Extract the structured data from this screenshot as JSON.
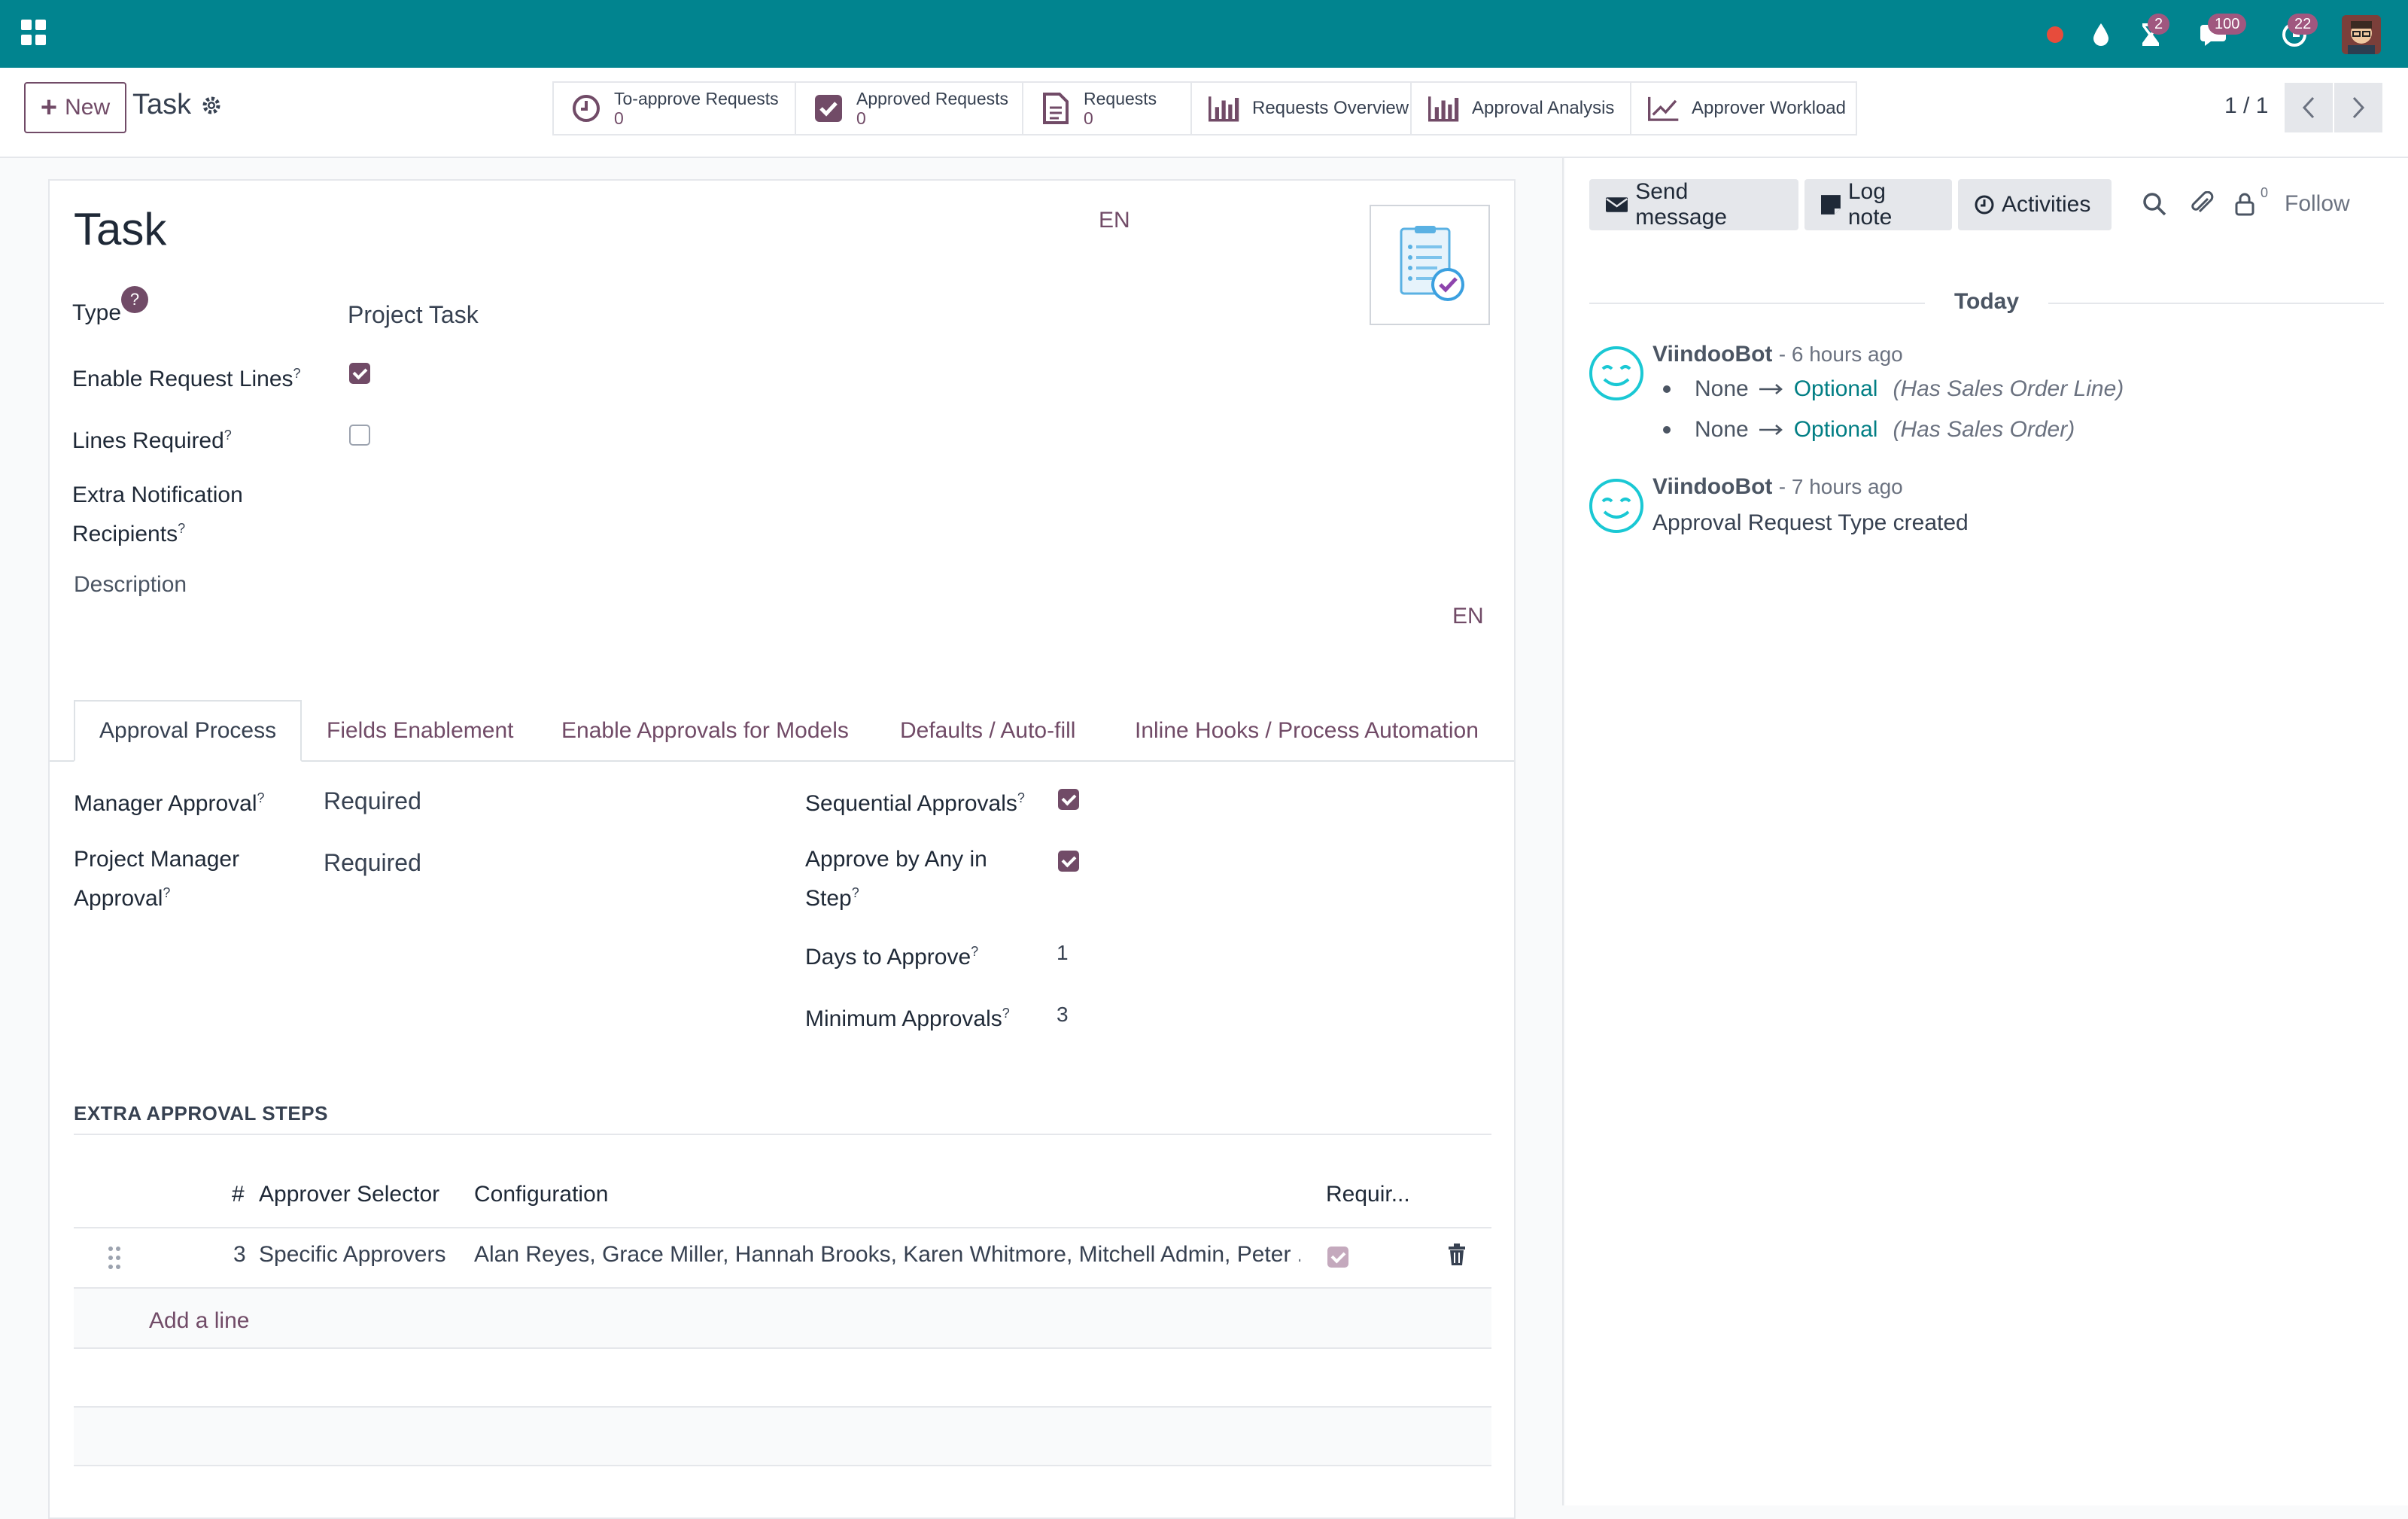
{
  "topbar": {
    "badges": {
      "activities": "2",
      "messages": "100",
      "clock": "22"
    }
  },
  "control": {
    "new_label": "New",
    "breadcrumb": "Task",
    "smart_buttons": {
      "to_approve": {
        "label": "To-approve Requests",
        "count": "0"
      },
      "approved": {
        "label": "Approved Requests",
        "count": "0"
      },
      "requests": {
        "label": "Requests",
        "count": "0"
      },
      "overview": {
        "label": "Requests Overview"
      },
      "analysis": {
        "label": "Approval Analysis"
      },
      "workload": {
        "label": "Approver Workload"
      }
    },
    "pager": "1 / 1"
  },
  "form": {
    "title": "Task",
    "lang_title": "EN",
    "lang_desc": "EN",
    "fields": {
      "type": {
        "label": "Type",
        "help": "?",
        "value": "Project Task"
      },
      "enable_request_lines": {
        "label": "Enable Request Lines",
        "checked": true
      },
      "lines_required": {
        "label": "Lines Required",
        "checked": false
      },
      "extra_recipients": {
        "label_line1": "Extra Notification",
        "label_line2": "Recipients"
      }
    },
    "description_label": "Description",
    "tabs": [
      {
        "label": "Approval Process",
        "active": true
      },
      {
        "label": "Fields Enablement"
      },
      {
        "label": "Enable Approvals for Models"
      },
      {
        "label": "Defaults / Auto-fill"
      },
      {
        "label": "Inline Hooks / Process Automation"
      }
    ],
    "approval": {
      "manager_approval": {
        "label": "Manager Approval",
        "value": "Required"
      },
      "pm_approval": {
        "label_line1": "Project Manager",
        "label_line2": "Approval",
        "value": "Required"
      },
      "sequential": {
        "label": "Sequential Approvals",
        "checked": true
      },
      "approve_any": {
        "label_line1": "Approve by Any in",
        "label_line2": "Step",
        "checked": true
      },
      "days": {
        "label": "Days to Approve",
        "value": "1"
      },
      "minimum": {
        "label": "Minimum Approvals",
        "value": "3"
      }
    },
    "extra_steps": {
      "title": "EXTRA APPROVAL STEPS",
      "columns": {
        "seq": "#",
        "selector": "Approver Selector",
        "config": "Configuration",
        "required": "Requir..."
      },
      "rows": [
        {
          "seq": "3",
          "selector": "Specific Approvers",
          "config": "Alan Reyes, Grace Miller, Hannah Brooks, Karen Whitmore, Mitchell Admin, Peter ...",
          "required": true
        }
      ],
      "add_line": "Add a line"
    }
  },
  "chatter": {
    "send_message": "Send message",
    "log_note": "Log note",
    "activities": "Activities",
    "follower_count": "0",
    "follow": "Follow",
    "today": "Today",
    "messages": [
      {
        "author": "ViindooBot",
        "ago": "- 6 hours ago",
        "tracking": [
          {
            "old": "None",
            "new": "Optional",
            "field": "(Has Sales Order Line)"
          },
          {
            "old": "None",
            "new": "Optional",
            "field": "(Has Sales Order)"
          }
        ]
      },
      {
        "author": "ViindooBot",
        "ago": "- 7 hours ago",
        "body": "Approval Request Type created"
      }
    ]
  },
  "colors": {
    "topbar": "#01848f",
    "primary": "#714b67",
    "link": "#017e84"
  }
}
